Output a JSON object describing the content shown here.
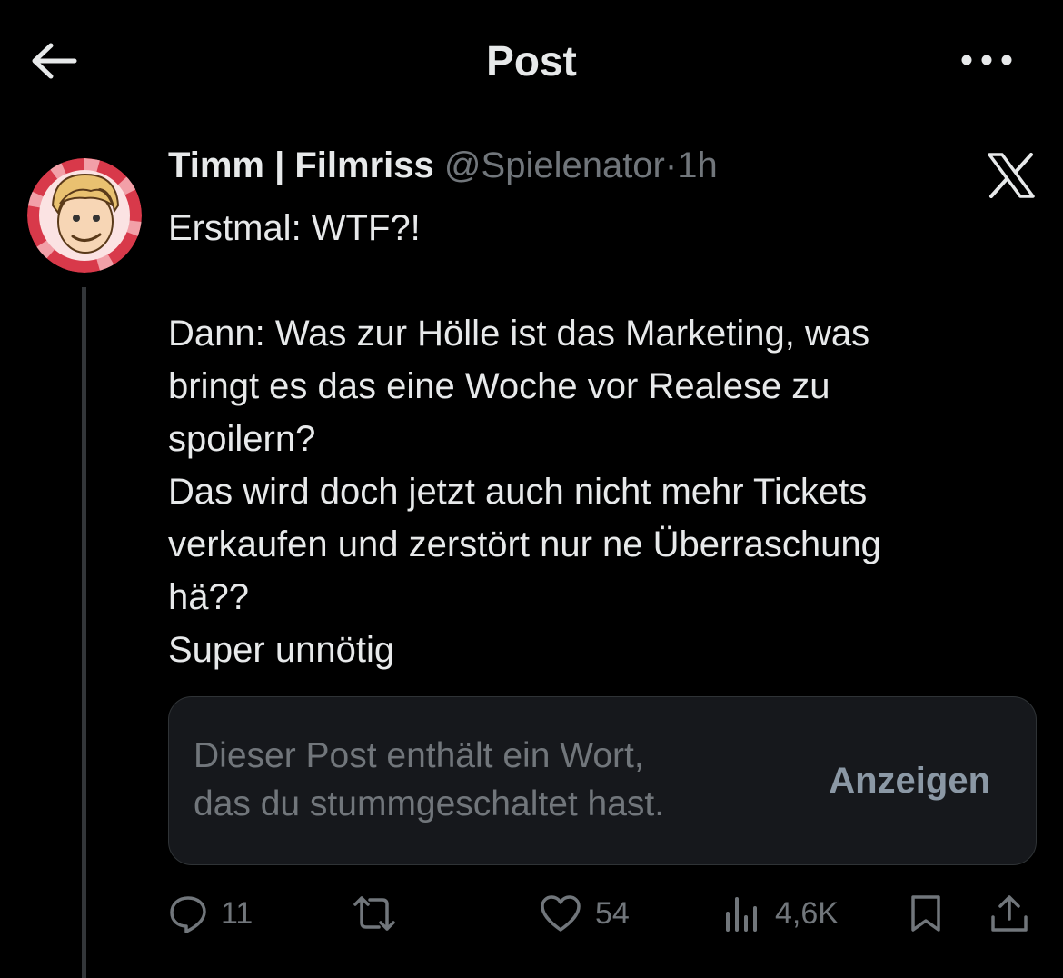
{
  "header": {
    "title": "Post"
  },
  "author": {
    "name": "Timm | Filmriss",
    "handle": "@Spielenator",
    "separator": "·",
    "time": "1h"
  },
  "tweet": {
    "line1": "Erstmal: WTF?!",
    "line2": "Dann: Was zur Hölle ist das Marketing, was",
    "line3": "bringt es das eine Woche vor Realese zu",
    "line4": "spoilern?",
    "line5": "Das wird doch jetzt auch nicht mehr Tickets",
    "line6": "verkaufen und zerstört nur ne Überraschung",
    "line7": "hä??",
    "line8": "Super unnötig"
  },
  "muted": {
    "line1": "Dieser Post enthält ein Wort,",
    "line2": "das du stummgeschaltet hast.",
    "button": "Anzeigen"
  },
  "actions": {
    "replies": "11",
    "likes": "54",
    "views": "4,6K"
  },
  "icons": [
    "back-arrow-icon",
    "more-icon",
    "x-logo-icon",
    "reply-icon",
    "repost-icon",
    "like-icon",
    "views-icon",
    "bookmark-icon",
    "share-icon"
  ]
}
